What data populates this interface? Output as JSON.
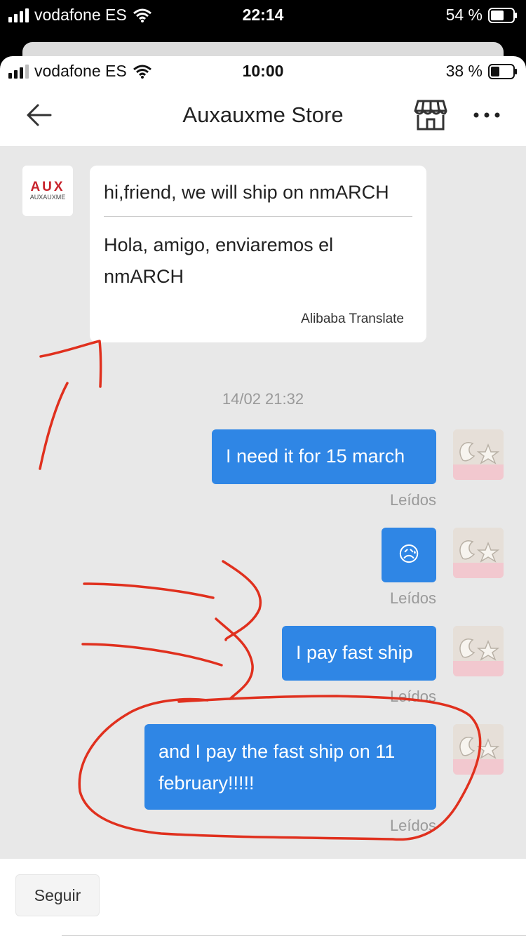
{
  "outer_status": {
    "carrier": "vodafone ES",
    "time": "22:14",
    "battery": "54 %"
  },
  "inner_status": {
    "carrier": "vodafone ES",
    "time": "10:00",
    "battery": "38 %"
  },
  "header": {
    "title": "Auxauxme Store",
    "back_icon": "arrow-left-icon",
    "store_icon": "storefront-icon",
    "more_icon": "more-dots-icon"
  },
  "shop": {
    "logo_main": "AUX",
    "logo_sub": "AUXAUXME"
  },
  "incoming": {
    "original": "hi,friend, we will ship on nmARCH",
    "translation": "Hola, amigo, enviaremos el nmARCH",
    "source": "Alibaba Translate"
  },
  "timestamp": "14/02 21:32",
  "messages": [
    {
      "text": "I need it for 15 march",
      "status": "Leídos"
    },
    {
      "text": "😥",
      "status": "Leídos"
    },
    {
      "text": "I pay fast ship",
      "status": "Leídos"
    },
    {
      "text": "and I pay the fast ship on 11 february!!!!!",
      "status": "Leídos"
    }
  ],
  "footer": {
    "follow_label": "Seguir"
  },
  "colors": {
    "bubble_out": "#2f86e5",
    "chat_bg": "#e8e8e8",
    "annotation": "#e0301e",
    "brand": "#c8232c"
  }
}
